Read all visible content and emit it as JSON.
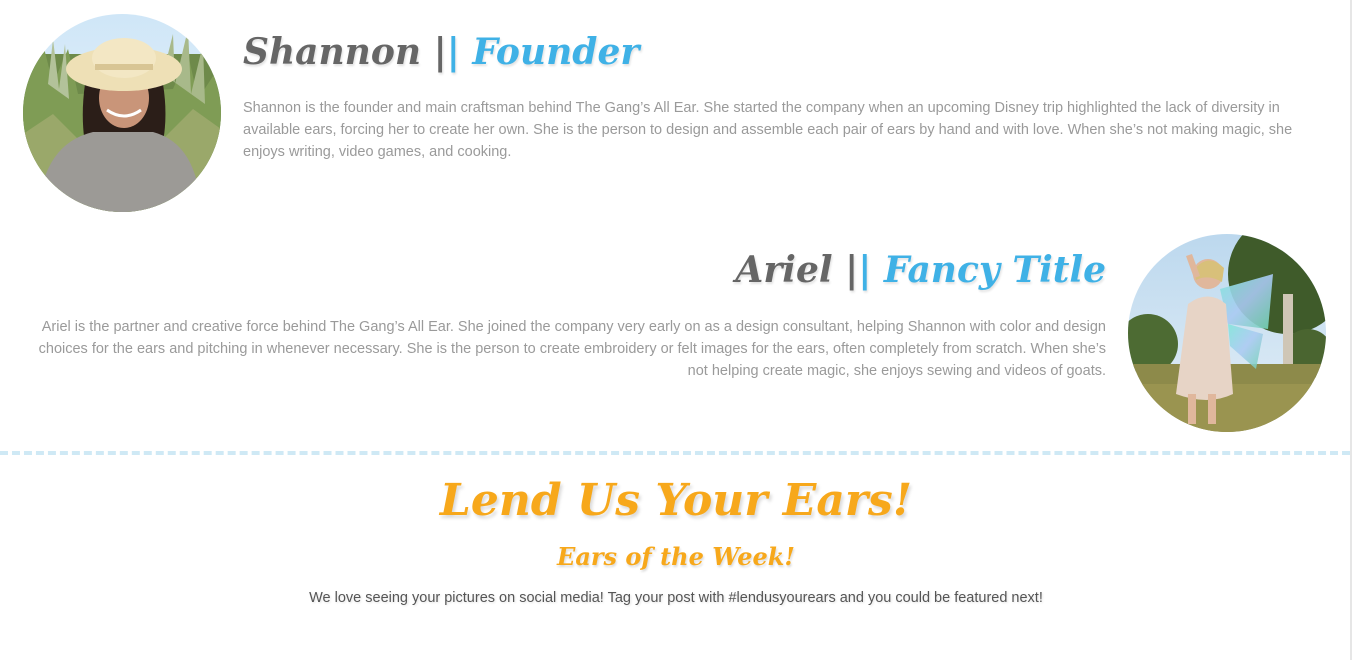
{
  "team": {
    "members": [
      {
        "name": "Shannon",
        "separator": "||",
        "role": "Founder",
        "bio": "Shannon is the founder and main craftsman behind The Gang’s All Ear. She started the company when an upcoming Disney trip highlighted the lack of diversity in available ears, forcing her to create her own. She is the person to design and assemble each pair of ears by hand and with love. When she’s not making magic, she enjoys writing, video games, and cooking."
      },
      {
        "name": "Ariel",
        "separator": "||",
        "role": "Fancy Title",
        "bio": "Ariel is the partner and creative force behind The Gang’s All Ear. She joined the company very early on as a design consultant, helping Shannon with color and design choices for the ears and pitching in whenever necessary. She is the person to create embroidery or felt images for the ears, often completely from scratch. When she’s not helping create magic, she enjoys sewing and videos of goats."
      }
    ]
  },
  "feature": {
    "title": "Lend Us Your Ears!",
    "subtitle": "Ears of the Week!",
    "text": "We love seeing your pictures on social media! Tag your post with #lendusyourears and you could be featured next!"
  },
  "colors": {
    "accent_blue": "#3fb1e6",
    "accent_orange": "#f7a81b",
    "name_gray": "#666666",
    "body_gray": "#9a9a9a",
    "divider": "#cfe9f5"
  }
}
